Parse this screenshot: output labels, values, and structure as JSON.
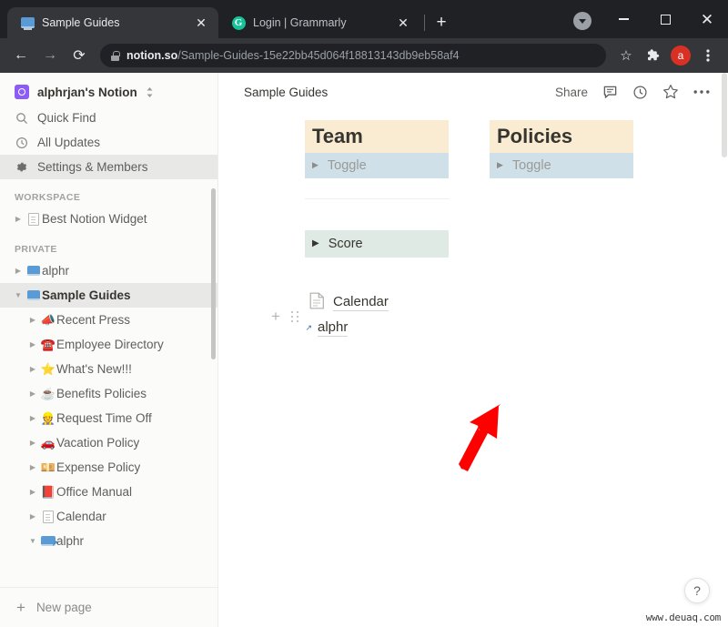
{
  "browser": {
    "tabs": [
      {
        "title": "Sample Guides",
        "favicon": "monitor-icon",
        "active": true,
        "close_label": "✕"
      },
      {
        "title": "Login | Grammarly",
        "favicon": "grammarly-g-icon",
        "active": false,
        "close_label": "✕"
      }
    ],
    "new_tab_label": "+",
    "window_controls": {
      "minimize": "–",
      "maximize": "□",
      "close": "✕"
    },
    "toolbar": {
      "back": "←",
      "forward": "→",
      "reload": "⟳",
      "url_domain": "notion.so",
      "url_path": "/Sample-Guides-15e22bb45d064f18813143db9eb58af4",
      "bookmark": "☆",
      "extensions": "🧩",
      "profile_initial": "a",
      "menu": "⋮"
    }
  },
  "sidebar": {
    "workspace": {
      "name": "alphrjan's Notion",
      "logo": "notion-workspace-logo"
    },
    "quick_items": [
      {
        "label": "Quick Find",
        "icon": "search-icon",
        "selected": false
      },
      {
        "label": "All Updates",
        "icon": "clock-icon",
        "selected": false
      },
      {
        "label": "Settings & Members",
        "icon": "gear-icon",
        "selected": true
      }
    ],
    "sections": [
      {
        "title": "WORKSPACE",
        "rows": [
          {
            "label": "Best Notion Widget",
            "emoji": "doc-icon",
            "indent": 0,
            "expanded": false,
            "selected": false,
            "bold": false
          }
        ]
      },
      {
        "title": "PRIVATE",
        "rows": [
          {
            "label": "alphr",
            "emoji": "monitor-icon",
            "indent": 0,
            "expanded": false,
            "selected": false,
            "bold": false
          },
          {
            "label": "Sample Guides",
            "emoji": "monitor-icon",
            "indent": 0,
            "expanded": true,
            "selected": true,
            "bold": true
          },
          {
            "label": "Recent Press",
            "emoji": "📣",
            "indent": 1,
            "expanded": false,
            "selected": false,
            "bold": false
          },
          {
            "label": "Employee Directory",
            "emoji": "☎️",
            "indent": 1,
            "expanded": false,
            "selected": false,
            "bold": false
          },
          {
            "label": "What's New!!!",
            "emoji": "⭐",
            "indent": 1,
            "expanded": false,
            "selected": false,
            "bold": false
          },
          {
            "label": "Benefits Policies",
            "emoji": "☕",
            "indent": 1,
            "expanded": false,
            "selected": false,
            "bold": false
          },
          {
            "label": "Request Time Off",
            "emoji": "👷",
            "indent": 1,
            "expanded": false,
            "selected": false,
            "bold": false
          },
          {
            "label": "Vacation Policy",
            "emoji": "🚗",
            "indent": 1,
            "expanded": false,
            "selected": false,
            "bold": false
          },
          {
            "label": "Expense Policy",
            "emoji": "💴",
            "indent": 1,
            "expanded": false,
            "selected": false,
            "bold": false
          },
          {
            "label": "Office Manual",
            "emoji": "📕",
            "indent": 1,
            "expanded": false,
            "selected": false,
            "bold": false
          },
          {
            "label": "Calendar",
            "emoji": "doc-icon",
            "indent": 1,
            "expanded": false,
            "selected": false,
            "bold": false
          },
          {
            "label": "alphr",
            "emoji": "monitor-link-icon",
            "indent": 1,
            "expanded": true,
            "selected": false,
            "bold": false
          }
        ]
      }
    ],
    "new_page": {
      "label": "New page",
      "icon": "plus-icon"
    }
  },
  "main": {
    "breadcrumb": {
      "icon": "monitor-icon",
      "title": "Sample Guides"
    },
    "header_actions": {
      "share": "Share",
      "comment_icon": "comment-icon",
      "history_icon": "clock-icon",
      "favorite_icon": "star-icon",
      "more_icon": "more-horizontal-icon"
    },
    "columns": [
      {
        "heading": "Team",
        "toggle": "Toggle",
        "toggle_arrow": "▶"
      },
      {
        "heading": "Policies",
        "toggle": "Toggle",
        "toggle_arrow": "▶"
      }
    ],
    "score_block": {
      "label": "Score",
      "arrow": "▶"
    },
    "block_handles": {
      "plus": "+",
      "grip": "drag-handle-icon"
    },
    "annotation": {
      "type": "red-arrow",
      "color": "#ff0000",
      "points_at": "add-block-plus-icon"
    },
    "page_links": [
      {
        "label": "Calendar",
        "icon": "doc-icon"
      },
      {
        "label": "alphr",
        "icon": "monitor-link-icon"
      }
    ],
    "help_button": "?",
    "watermark": "www.deuaq.com"
  },
  "colors": {
    "heading_bg": "#f9ecd2",
    "toggle_bg": "#cfe0e8",
    "score_bg": "#dfeae4",
    "sidebar_bg": "#fbfbfa",
    "selected_bg": "#e8e8e7",
    "annotation_red": "#ff0000",
    "browser_chrome": "#202124"
  }
}
